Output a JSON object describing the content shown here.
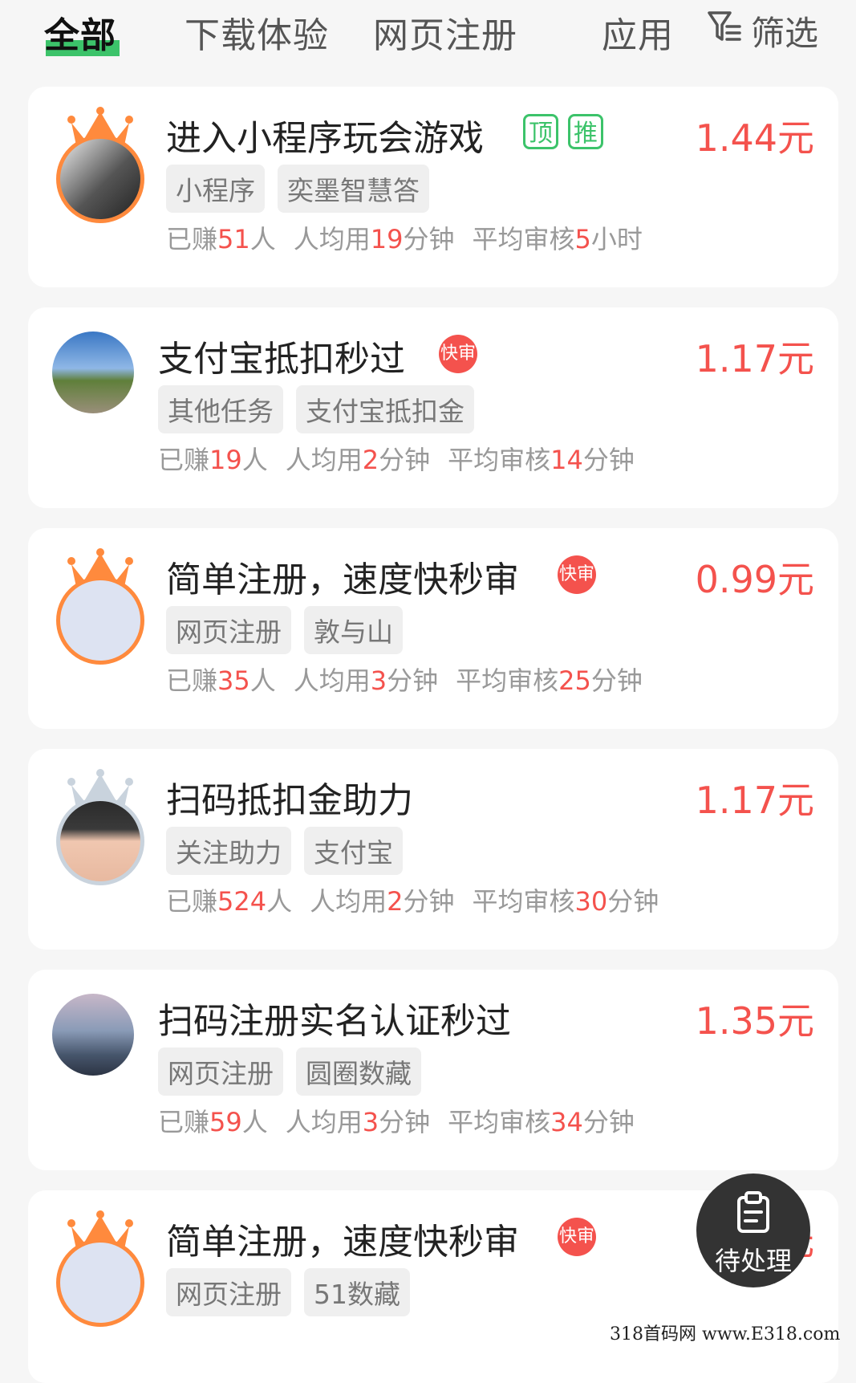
{
  "tabs": [
    {
      "label": "全部",
      "active": true
    },
    {
      "label": "下载体验"
    },
    {
      "label": "网页注册"
    },
    {
      "label": "应用"
    }
  ],
  "filter": {
    "label": "筛选",
    "icon": "filter-icon"
  },
  "stats_labels": {
    "earned_prefix": "已赚",
    "earned_suffix": "人",
    "avg_prefix": "人均用",
    "avg_suffix": "分钟",
    "review_prefix": "平均审核"
  },
  "tasks": [
    {
      "title": "进入小程序玩会游戏",
      "price": "1.44元",
      "badges": [
        "顶",
        "推"
      ],
      "tags": [
        "小程序",
        "奕墨智慧答"
      ],
      "earned": "51",
      "avg": "19",
      "review": "5",
      "review_unit": "小时",
      "crown": "orange"
    },
    {
      "title": "支付宝抵扣秒过",
      "price": "1.17元",
      "fast": "快审",
      "tags": [
        "其他任务",
        "支付宝抵扣金"
      ],
      "earned": "19",
      "avg": "2",
      "review": "14",
      "review_unit": "分钟",
      "crown": "none"
    },
    {
      "title": "简单注册，速度快秒审",
      "price": "0.99元",
      "fast": "快审",
      "tags": [
        "网页注册",
        "敦与山"
      ],
      "earned": "35",
      "avg": "3",
      "review": "25",
      "review_unit": "分钟",
      "crown": "orange"
    },
    {
      "title": "扫码抵扣金助力",
      "price": "1.17元",
      "tags": [
        "关注助力",
        "支付宝"
      ],
      "earned": "524",
      "avg": "2",
      "review": "30",
      "review_unit": "分钟",
      "crown": "silver"
    },
    {
      "title": "扫码注册实名认证秒过",
      "price": "1.35元",
      "tags": [
        "网页注册",
        "圆圈数藏"
      ],
      "earned": "59",
      "avg": "3",
      "review": "34",
      "review_unit": "分钟",
      "crown": "none"
    },
    {
      "title": "简单注册，速度快秒审",
      "price": "1元",
      "fast": "快审",
      "tags": [
        "网页注册",
        "51数藏"
      ],
      "crown": "orange"
    }
  ],
  "fab": {
    "label": "待处理",
    "icon": "clipboard-icon"
  },
  "watermark": "318首码网 www.E318.com",
  "colors": {
    "accent": "#3cc36a",
    "price": "#f4524d",
    "crown_orange": "#ff8a3d"
  }
}
